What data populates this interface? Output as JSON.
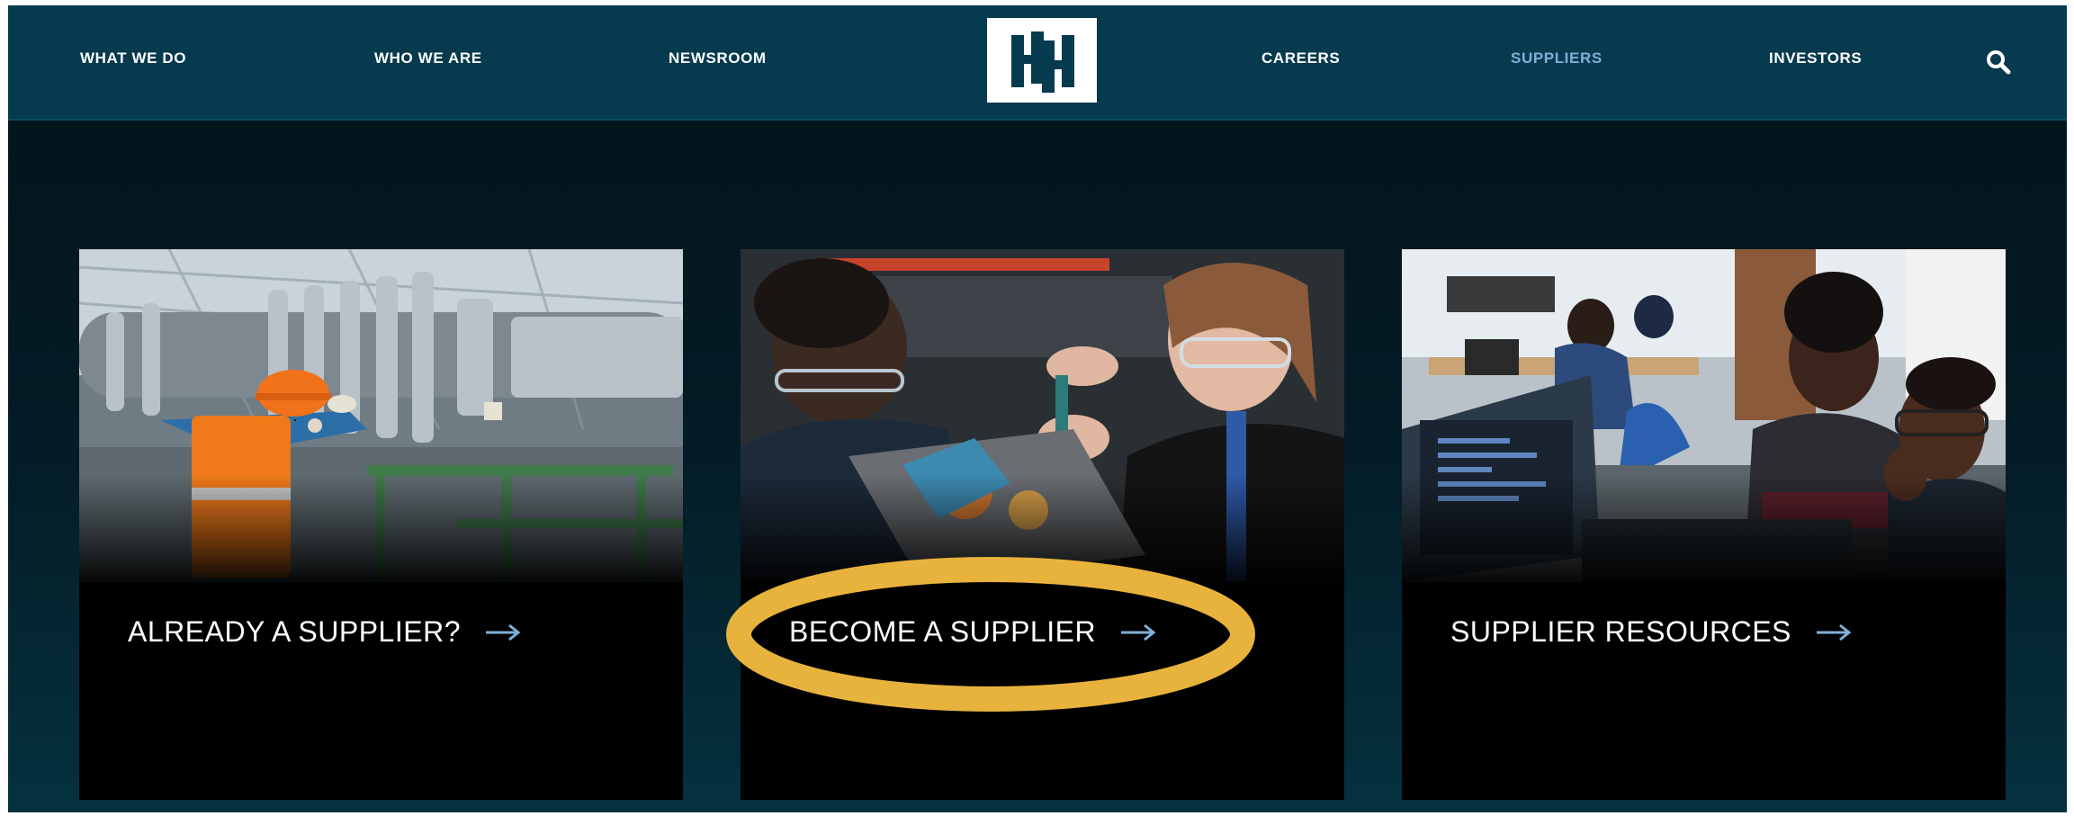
{
  "nav": {
    "left_items": [
      "WHAT WE DO",
      "WHO WE ARE",
      "NEWSROOM"
    ],
    "right_items": [
      "CAREERS",
      "SUPPLIERS",
      "INVESTORS"
    ],
    "active_item": "SUPPLIERS",
    "logo_icon": "hh-logo-icon",
    "search_icon": "search-icon"
  },
  "cards": [
    {
      "title": "ALREADY A SUPPLIER?",
      "icon": "arrow-right-icon"
    },
    {
      "title": "BECOME A SUPPLIER",
      "icon": "arrow-right-icon"
    },
    {
      "title": "SUPPLIER RESOURCES",
      "icon": "arrow-right-icon"
    }
  ],
  "colors": {
    "nav_bg": "#063a4e",
    "active_link": "#7fb0d8",
    "arrow": "#7fb0d8",
    "highlight_ring": "#e8b33c"
  }
}
